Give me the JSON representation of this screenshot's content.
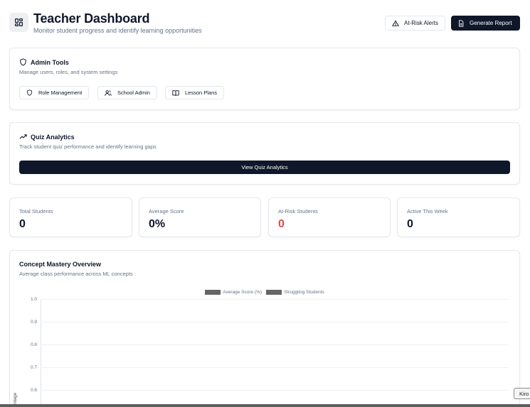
{
  "header": {
    "title": "Teacher Dashboard",
    "subtitle": "Monitor student progress and identify learning opportunities",
    "at_risk_label": "At-Risk Alerts",
    "report_label": "Generate Report"
  },
  "admin_tools": {
    "title": "Admin Tools",
    "description": "Manage users, roles, and system settings",
    "buttons": [
      {
        "label": "Role Management",
        "icon": "shield-icon"
      },
      {
        "label": "School Admin",
        "icon": "users-icon"
      },
      {
        "label": "Lesson Plans",
        "icon": "book-open-icon"
      }
    ]
  },
  "quiz_analytics": {
    "title": "Quiz Analytics",
    "description": "Track student quiz performance and identify learning gaps",
    "button_label": "View Quiz Analytics"
  },
  "stats": [
    {
      "label": "Total Students",
      "value": "0"
    },
    {
      "label": "Average Score",
      "value": "0%"
    },
    {
      "label": "At-Risk Students",
      "value": "0",
      "color": "#dc4a4a"
    },
    {
      "label": "Active This Week",
      "value": "0"
    }
  ],
  "concept_mastery": {
    "title": "Concept Mastery Overview",
    "description": "Average class performance across ML concepts"
  },
  "chart_data": {
    "type": "bar",
    "categories": [],
    "series": [
      {
        "name": "Average Score (%)",
        "values": [],
        "color": "#666666"
      },
      {
        "name": "Struggling Students",
        "values": [],
        "color": "#666666"
      }
    ],
    "yticks": [
      "1.0",
      "0.9",
      "0.8",
      "0.7",
      "0.6"
    ],
    "ylabel": "ntage",
    "legend": "top-center"
  },
  "tooltip": {
    "text": "Kiro"
  },
  "colors": {
    "primary": "#0f172a",
    "danger": "#dc4a4a",
    "muted": "#64748b"
  }
}
